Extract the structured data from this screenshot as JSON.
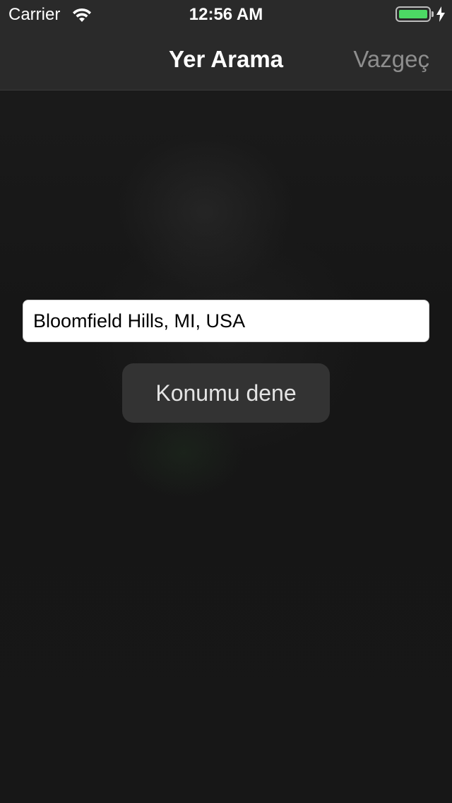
{
  "status_bar": {
    "carrier": "Carrier",
    "time": "12:56 AM",
    "wifi_icon": "wifi-icon",
    "battery_icon": "battery-icon",
    "charging_icon": "bolt-icon",
    "battery_level": 1.0,
    "battery_color": "#4cd964"
  },
  "nav": {
    "title": "Yer Arama",
    "cancel_label": "Vazgeç"
  },
  "search": {
    "value": "Bloomfield Hills, MI, USA"
  },
  "actions": {
    "try_location_label": "Konumu dene"
  },
  "colors": {
    "background": "#161616",
    "nav_background": "#2a2a2a",
    "button_background": "#333333",
    "cancel_text": "#8e8e8e"
  }
}
